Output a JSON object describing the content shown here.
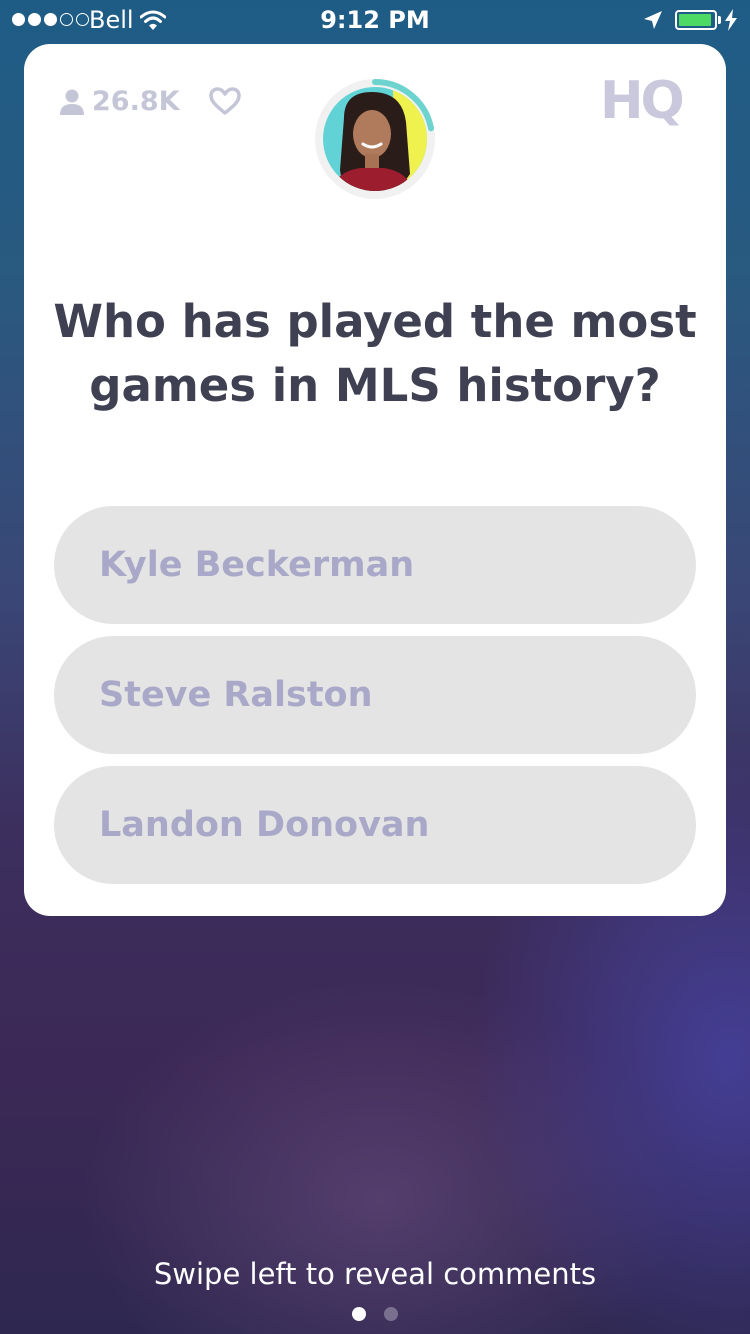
{
  "status_bar": {
    "carrier": "Bell",
    "time": "9:12 PM",
    "signal_bars_filled": 3,
    "signal_bars_total": 5,
    "battery_level": 0.95,
    "battery_color": "#4cd964",
    "icons": [
      "wifi-icon",
      "location-arrow-icon",
      "battery-icon",
      "charging-bolt-icon"
    ]
  },
  "game": {
    "viewer_count": "26.8K",
    "logo": "HQ",
    "timer_progress": 0.22,
    "timer_color": "#6cd3cf",
    "question": "Who has played the most games in MLS history?",
    "answers": [
      {
        "label": "Kyle Beckerman"
      },
      {
        "label": "Steve Ralston"
      },
      {
        "label": "Landon Donovan"
      }
    ]
  },
  "footer": {
    "hint": "Swipe left to reveal comments",
    "pages_total": 2,
    "current_page": 1
  },
  "colors": {
    "card_background": "#ffffff",
    "question_text": "#3f4052",
    "answer_background": "#e4e4e4",
    "answer_text": "#a9a8c8",
    "muted_icons": "#c4c5d6"
  }
}
